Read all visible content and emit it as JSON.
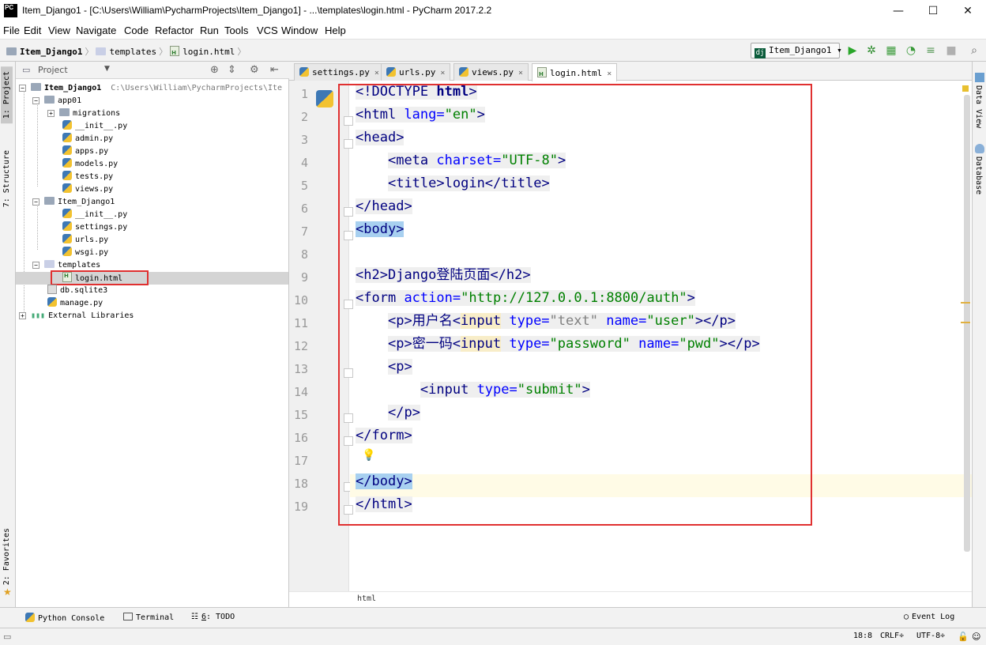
{
  "window": {
    "title": "Item_Django1 - [C:\\Users\\William\\PycharmProjects\\Item_Django1] - ...\\templates\\login.html - PyCharm 2017.2.2",
    "app_logo": "PC",
    "minimize": "—",
    "maximize": "☐",
    "close": "✕"
  },
  "menu": [
    "File",
    "Edit",
    "View",
    "Navigate",
    "Code",
    "Refactor",
    "Run",
    "Tools",
    "VCS",
    "Window",
    "Help"
  ],
  "breadcrumb": {
    "project": "Item_Django1",
    "folder": "templates",
    "file": "login.html"
  },
  "run_config": {
    "label": "Item_Django1",
    "icon_text": "dj"
  },
  "left_tool_tabs": {
    "project": "1: Project",
    "structure": "7: Structure",
    "favorites": "2: Favorites"
  },
  "right_tool_tabs": {
    "data_view": "Data View",
    "database": "Database"
  },
  "project_panel": {
    "title": "Project",
    "root": "Item_Django1",
    "root_path": "C:\\Users\\William\\PycharmProjects\\Ite",
    "items": [
      {
        "label": "app01"
      },
      {
        "label": "migrations"
      },
      {
        "label": "__init__.py"
      },
      {
        "label": "admin.py"
      },
      {
        "label": "apps.py"
      },
      {
        "label": "models.py"
      },
      {
        "label": "tests.py"
      },
      {
        "label": "views.py"
      },
      {
        "label": "Item_Django1"
      },
      {
        "label": "__init__.py"
      },
      {
        "label": "settings.py"
      },
      {
        "label": "urls.py"
      },
      {
        "label": "wsgi.py"
      },
      {
        "label": "templates"
      },
      {
        "label": "login.html"
      },
      {
        "label": "db.sqlite3"
      },
      {
        "label": "manage.py"
      },
      {
        "label": "External Libraries"
      }
    ]
  },
  "tabs": [
    {
      "label": "settings.py"
    },
    {
      "label": "urls.py"
    },
    {
      "label": "views.py"
    },
    {
      "label": "login.html"
    }
  ],
  "tab_close": "×",
  "line_numbers": [
    "1",
    "2",
    "3",
    "4",
    "5",
    "6",
    "7",
    "8",
    "9",
    "10",
    "11",
    "12",
    "13",
    "14",
    "15",
    "16",
    "17",
    "18",
    "19"
  ],
  "code": {
    "l1": {
      "a": "<!DOCTYPE ",
      "b": "html",
      "c": ">"
    },
    "l2": {
      "a": "<",
      "b": "html ",
      "c": "lang=",
      "d": "\"en\"",
      "e": ">"
    },
    "l3": {
      "a": "<",
      "b": "head",
      "c": ">"
    },
    "l4": {
      "a": "<",
      "b": "meta ",
      "c": "charset=",
      "d": "\"UTF-8\"",
      "e": ">"
    },
    "l5": {
      "a": "<",
      "b": "title",
      "c": ">login</",
      "d": "title",
      "e": ">"
    },
    "l6": {
      "a": "</",
      "b": "head",
      "c": ">"
    },
    "l7": {
      "a": "<",
      "b": "body",
      "c": ">"
    },
    "l9": {
      "a": "<",
      "b": "h2",
      "c": ">Django登陆页面</",
      "d": "h2",
      "e": ">"
    },
    "l10": {
      "a": "<",
      "b": "form ",
      "c": "action=",
      "d": "\"http://127.0.0.1:8800/auth\"",
      "e": ">"
    },
    "l11": {
      "a": "<",
      "b": "p",
      "c": ">用户名<",
      "d": "input",
      "e": " type=",
      "f": "\"text\"",
      "g": " name=",
      "h": "\"user\"",
      "i": "></",
      "j": "p",
      "k": ">"
    },
    "l12": {
      "a": "<",
      "b": "p",
      "c": ">密一码<",
      "d": "input",
      "e": " type=",
      "f": "\"password\"",
      "g": " name=",
      "h": "\"pwd\"",
      "i": "></",
      "j": "p",
      "k": ">"
    },
    "l13": {
      "a": "<",
      "b": "p",
      "c": ">"
    },
    "l14": {
      "a": "<",
      "b": "input ",
      "c": "type=",
      "d": "\"submit\"",
      "e": ">"
    },
    "l15": {
      "a": "</",
      "b": "p",
      "c": ">"
    },
    "l16": {
      "a": "</",
      "b": "form",
      "c": ">"
    },
    "l18": {
      "a": "</",
      "b": "body",
      "c": ">"
    },
    "l19": {
      "a": "</",
      "b": "html",
      "c": ">"
    }
  },
  "editor_breadcrumb": "html",
  "tool_windows": {
    "python_console": "Python Console",
    "terminal": "Terminal",
    "todo_num": "6",
    "todo": ": TODO",
    "event_log": "Event Log"
  },
  "status": {
    "position": "18:8",
    "line_sep": "CRLF÷",
    "encoding": "UTF-8÷"
  },
  "colors": {
    "tag": "#000080",
    "attr": "#0000ff",
    "string": "#008000",
    "annotation_box": "#e03030"
  }
}
